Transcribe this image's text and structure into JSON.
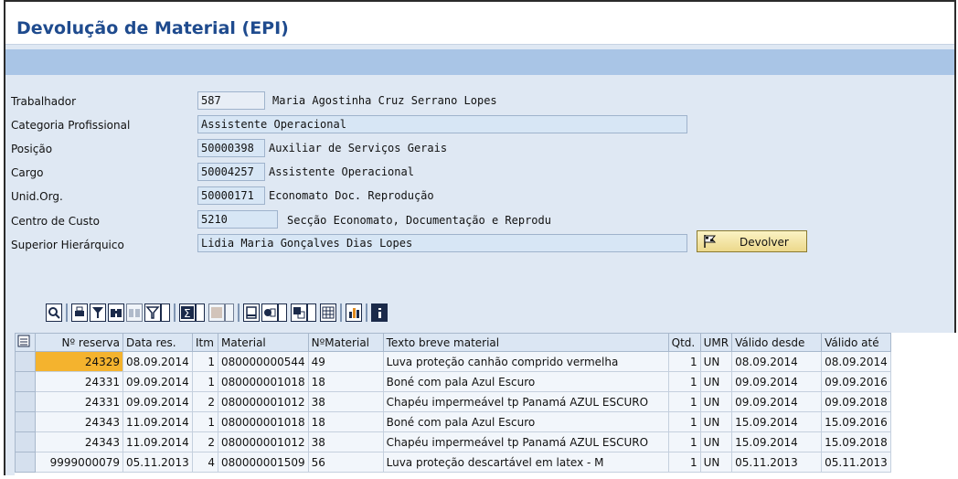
{
  "title": "Devolução de Material (EPI)",
  "form": {
    "trabalhador": {
      "label": "Trabalhador",
      "code": "587",
      "text": "Maria Agostinha Cruz Serrano Lopes"
    },
    "categoria": {
      "label": "Categoria Profissional",
      "value": "Assistente Operacional"
    },
    "posicao": {
      "label": "Posição",
      "code": "50000398",
      "text": "Auxiliar de Serviços Gerais"
    },
    "cargo": {
      "label": "Cargo",
      "code": "50004257",
      "text": "Assistente Operacional"
    },
    "unid": {
      "label": "Unid.Org.",
      "code": "50000171",
      "text": "Economato Doc. Reprodução"
    },
    "centro": {
      "label": "Centro de Custo",
      "code": "5210",
      "text": "Secção Economato, Documentação e Reprodu"
    },
    "superior": {
      "label": "Superior Hierárquico",
      "value": "Lidia Maria Gonçalves Dias Lopes"
    }
  },
  "buttons": {
    "devolver": "Devolver"
  },
  "toolbar_icons": [
    "details-icon",
    "print-icon",
    "filter-icon",
    "find-icon",
    "find-next-icon",
    "set-filter-icon",
    "sum-icon",
    "subtotal-icon",
    "print-preview-icon",
    "export-icon",
    "layout-icon",
    "grid-icon",
    "graphic-icon",
    "info-icon"
  ],
  "table": {
    "columns": [
      "Nº reserva",
      "Data res.",
      "Itm",
      "Material",
      "NºMaterial",
      "Texto breve material",
      "Qtd.",
      "UMR",
      "Válido desde",
      "Válido até"
    ],
    "rows": [
      [
        "24329",
        "08.09.2014",
        "1",
        "080000000544",
        "49",
        "Luva proteção canhão comprido vermelha",
        "1",
        "UN",
        "08.09.2014",
        "08.09.2014"
      ],
      [
        "24331",
        "09.09.2014",
        "1",
        "080000001018",
        "18",
        "Boné com pala Azul Escuro",
        "1",
        "UN",
        "09.09.2014",
        "09.09.2016"
      ],
      [
        "24331",
        "09.09.2014",
        "2",
        "080000001012",
        "38",
        "Chapéu impermeável tp Panamá AZUL ESCURO",
        "1",
        "UN",
        "09.09.2014",
        "09.09.2018"
      ],
      [
        "24343",
        "11.09.2014",
        "1",
        "080000001018",
        "18",
        "Boné com pala Azul Escuro",
        "1",
        "UN",
        "15.09.2014",
        "15.09.2016"
      ],
      [
        "24343",
        "11.09.2014",
        "2",
        "080000001012",
        "38",
        "Chapéu impermeável tp Panamá AZUL ESCURO",
        "1",
        "UN",
        "15.09.2014",
        "15.09.2018"
      ],
      [
        "9999000079",
        "05.11.2013",
        "4",
        "080000001509",
        "56",
        "Luva proteção descartável em latex - M",
        "1",
        "UN",
        "05.11.2013",
        "05.11.2013"
      ]
    ]
  }
}
